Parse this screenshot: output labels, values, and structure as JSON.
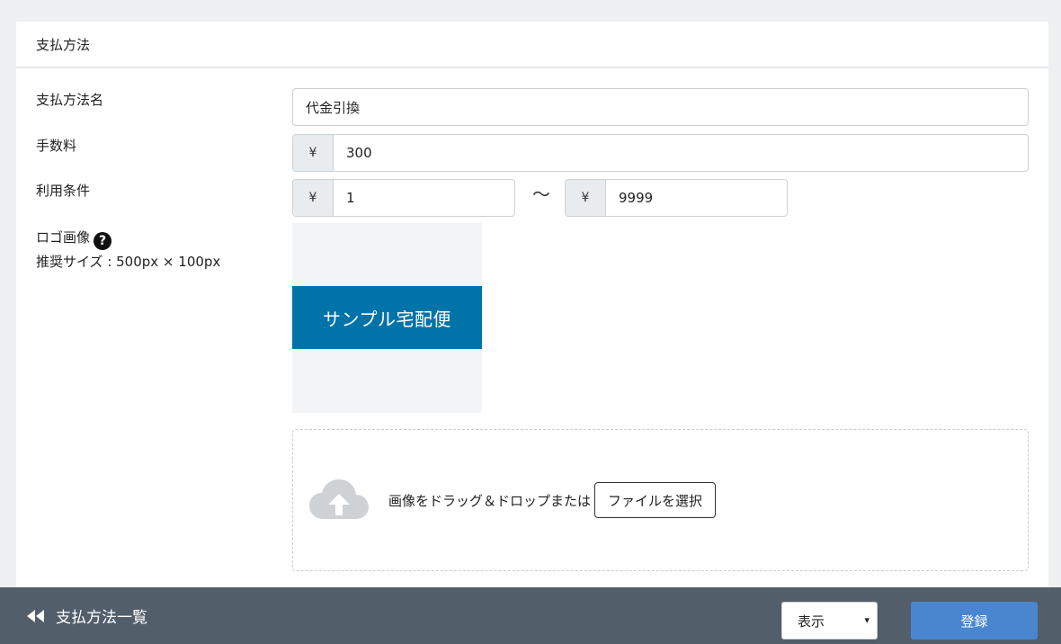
{
  "card": {
    "title": "支払方法"
  },
  "form": {
    "name": {
      "label": "支払方法名",
      "value": "代金引換"
    },
    "fee": {
      "label": "手数料",
      "currency": "¥",
      "value": "300"
    },
    "conditions": {
      "label": "利用条件",
      "min_currency": "¥",
      "min_value": "1",
      "separator": "〜",
      "max_currency": "¥",
      "max_value": "9999"
    },
    "logo": {
      "label": "ロゴ画像",
      "help_icon": "question-circle-icon",
      "help_glyph": "?",
      "hint": "推奨サイズ : 500px × 100px",
      "preview_text": "サンプル宅配便",
      "preview_color": "#0073a8"
    },
    "upload": {
      "icon": "cloud-upload-icon",
      "text": "画像をドラッグ＆ドロップまたは",
      "button_label": "ファイルを選択"
    }
  },
  "footer": {
    "back_icon": "double-chevron-left-icon",
    "back_label": "支払方法一覧",
    "visibility_select": {
      "selected": "表示",
      "caret": "▾"
    },
    "submit_label": "登録",
    "submit_color": "#4a86cf"
  }
}
